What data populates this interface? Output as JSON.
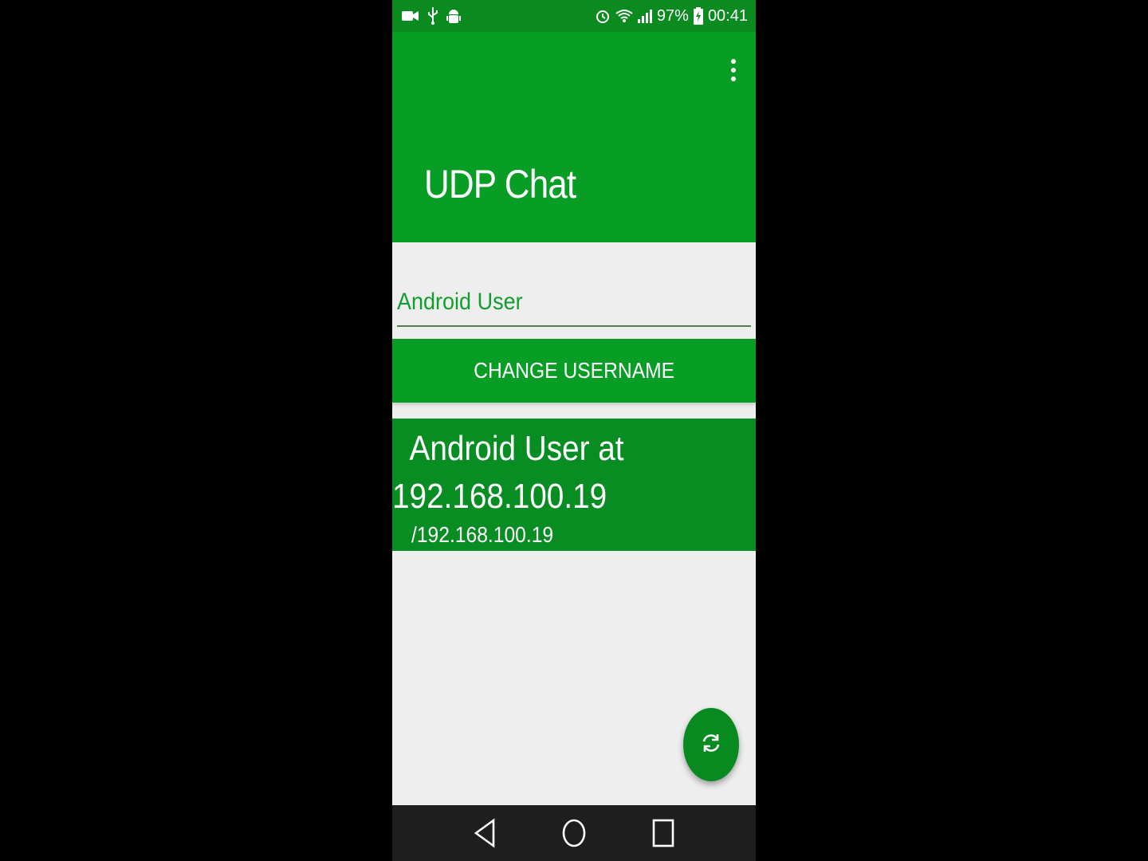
{
  "status_bar": {
    "battery_percent": "97%",
    "time": "00:41",
    "left_icons": [
      "screen-record-icon",
      "usb-icon",
      "android-debug-icon"
    ],
    "right_icons": [
      "alarm-icon",
      "wifi-icon",
      "signal-icon",
      "battery-charging-icon"
    ]
  },
  "app_bar": {
    "title": "UDP Chat",
    "overflow_icon": "more-vert-icon"
  },
  "username_field": {
    "value": "Android User"
  },
  "change_button": {
    "label": "CHANGE USERNAME"
  },
  "peers": [
    {
      "name_line": "  Android User at\n192.168.100.19",
      "address": "/192.168.100.19"
    }
  ],
  "fab": {
    "icon": "refresh-icon"
  },
  "nav_bar": {
    "icons": [
      "back-icon",
      "home-icon",
      "recents-icon"
    ]
  },
  "colors": {
    "primary": "#089e25",
    "primary_dark": "#0b8a1f",
    "card": "#088d23",
    "accent_text": "#129e2e",
    "background": "#eeeeee"
  }
}
